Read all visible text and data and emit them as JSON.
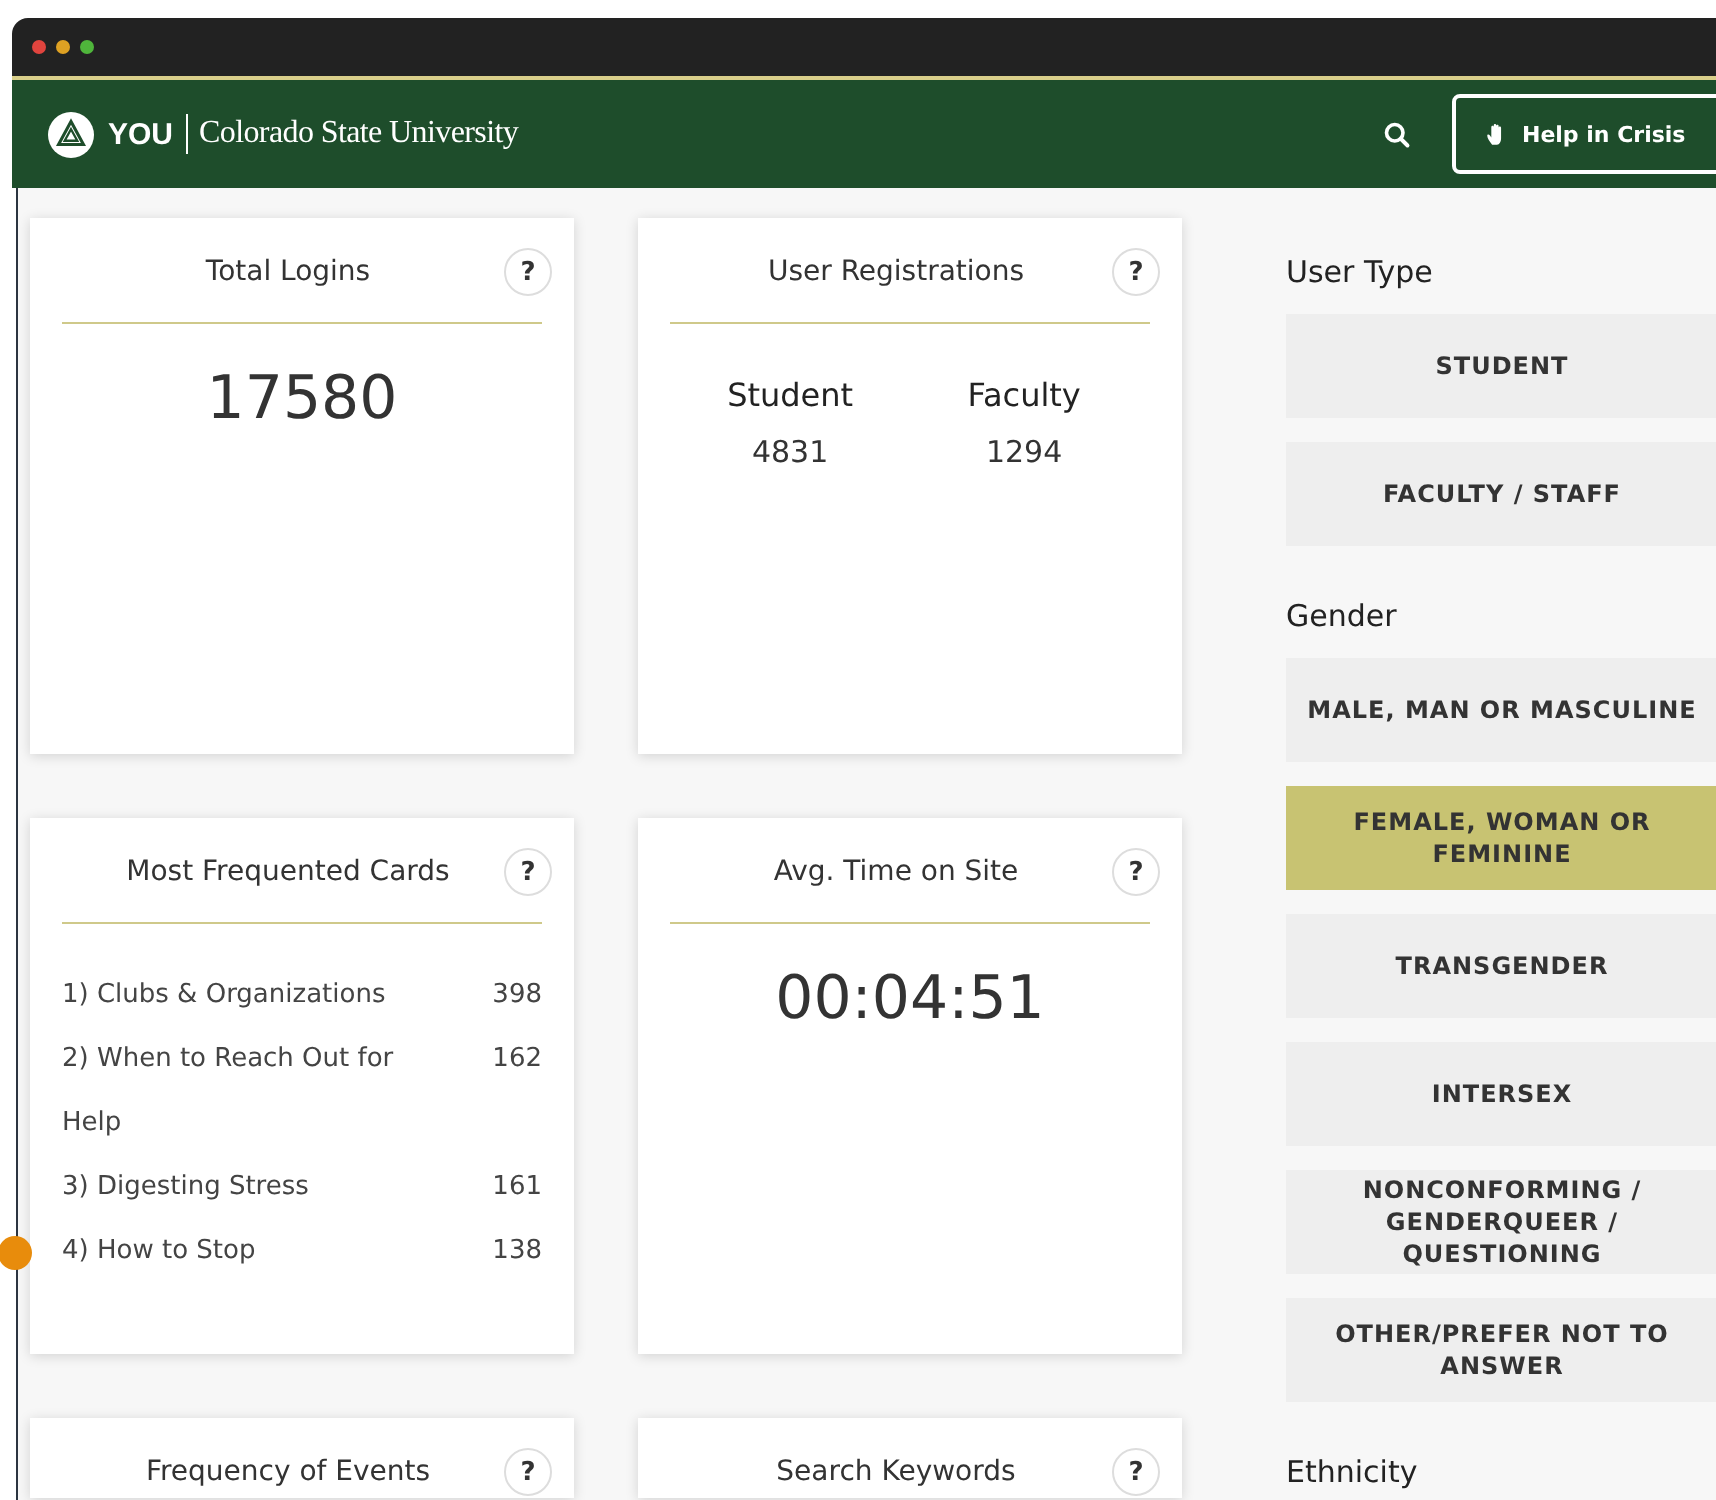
{
  "header": {
    "logo_you": "YOU",
    "logo_university": "Colorado State University",
    "help_button": "Help in Crisis"
  },
  "cards": [
    {
      "kind": "total",
      "title": "Total Logins",
      "help": "?",
      "value": "17580"
    },
    {
      "kind": "split",
      "title": "User Registrations",
      "help": "?",
      "columns": [
        {
          "label": "Student",
          "value": "4831"
        },
        {
          "label": "Faculty",
          "value": "1294"
        }
      ]
    },
    {
      "kind": "list",
      "title": "Most Frequented Cards",
      "help": "?",
      "items": [
        {
          "label": "1) Clubs & Organizations",
          "count": "398"
        },
        {
          "label": "2) When to Reach Out for Help",
          "count": "162"
        },
        {
          "label": "3) Digesting Stress",
          "count": "161"
        },
        {
          "label": "4) How to Stop",
          "count": "138"
        }
      ]
    },
    {
      "kind": "total",
      "title": "Avg. Time on Site",
      "help": "?",
      "value": "00:04:51"
    },
    {
      "kind": "empty",
      "title": "Frequency of Events",
      "help": "?"
    },
    {
      "kind": "empty",
      "title": "Search Keywords",
      "help": "?"
    }
  ],
  "filters": [
    {
      "label": "User Type",
      "options": [
        {
          "label": "STUDENT",
          "selected": false
        },
        {
          "label": "FACULTY / STAFF",
          "selected": false
        }
      ]
    },
    {
      "label": "Gender",
      "options": [
        {
          "label": "MALE, MAN OR MASCULINE",
          "selected": false
        },
        {
          "label": "FEMALE, WOMAN OR FEMININE",
          "selected": true
        },
        {
          "label": "TRANSGENDER",
          "selected": false
        },
        {
          "label": "INTERSEX",
          "selected": false
        },
        {
          "label": "NONCONFORMING / GENDERQUEER / QUESTIONING",
          "selected": false
        },
        {
          "label": "OTHER/PREFER NOT TO ANSWER",
          "selected": false
        }
      ]
    },
    {
      "label": "Ethnicity"
    }
  ]
}
